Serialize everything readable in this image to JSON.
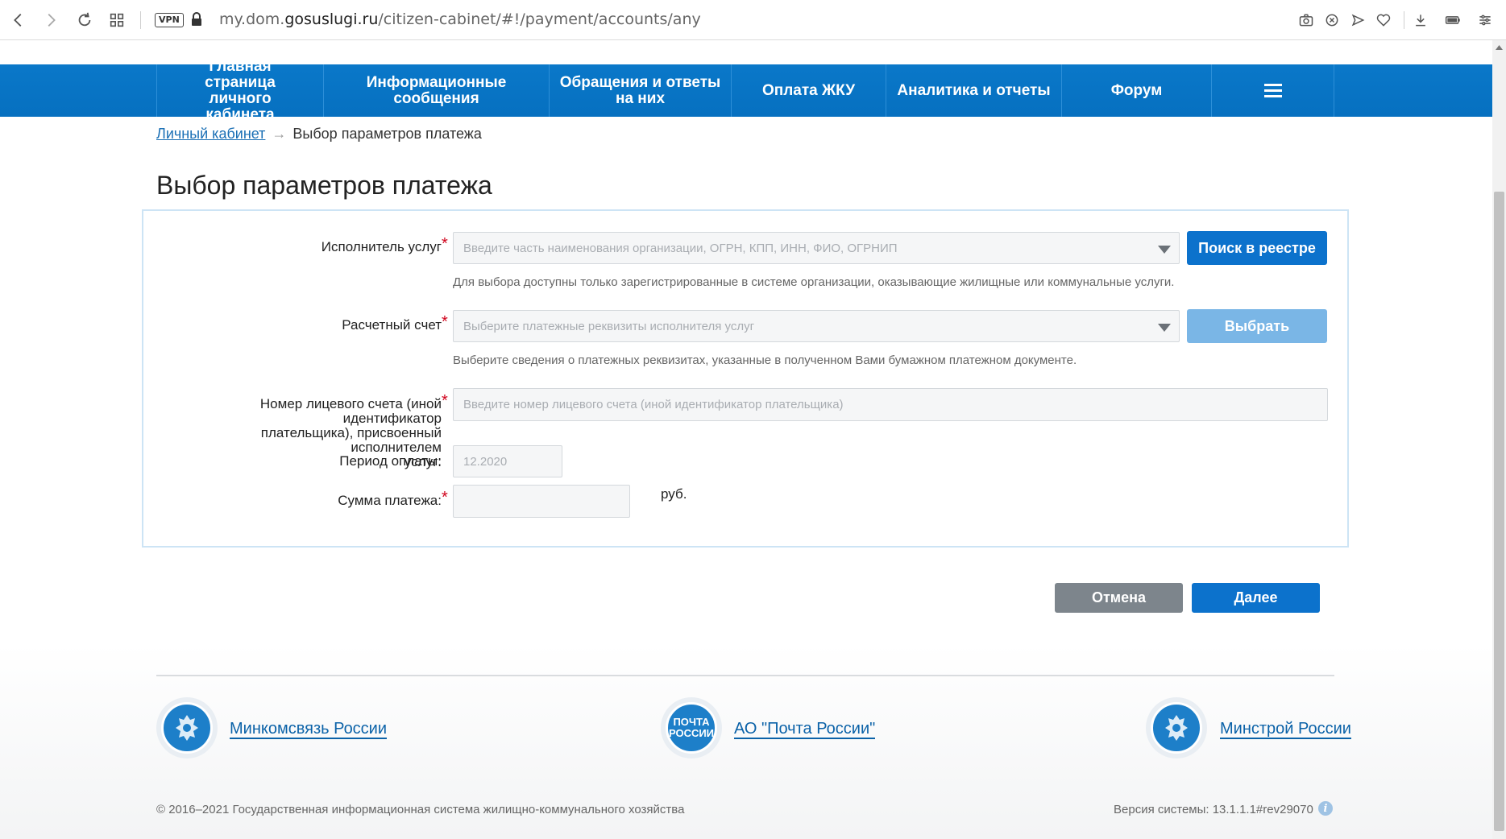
{
  "browser": {
    "vpn_label": "VPN",
    "url_prefix": "my.dom.",
    "url_host": "gosuslugi.ru",
    "url_path": "/citizen-cabinet/#!/payment/accounts/any",
    "icons": [
      "back-icon",
      "forward-icon",
      "reload-icon",
      "grid-icon",
      "lock-icon",
      "camera-icon",
      "close-circle-icon",
      "send-icon",
      "heart-icon",
      "download-icon",
      "battery-icon",
      "settings-icon"
    ]
  },
  "nav": {
    "items": [
      {
        "label": "Главная страница личного кабинета"
      },
      {
        "label": "Информационные сообщения"
      },
      {
        "label": "Обращения и ответы на них"
      },
      {
        "label": "Оплата ЖКУ"
      },
      {
        "label": "Аналитика и отчеты"
      },
      {
        "label": "Форум"
      }
    ],
    "menu_icon": "hamburger-icon"
  },
  "breadcrumb": {
    "link": "Личный кабинет",
    "arrow": "→",
    "current": "Выбор параметров платежа"
  },
  "page": {
    "title": "Выбор параметров платежа"
  },
  "form": {
    "provider": {
      "label": "Исполнитель услуг",
      "placeholder": "Введите часть наименования организации, ОГРН, КПП, ИНН, ФИО, ОГРНИП",
      "hint": "Для выбора доступны только зарегистрированные в системе организации, оказывающие жилищные или коммунальные услуги.",
      "button": "Поиск в реестре"
    },
    "account": {
      "label": "Расчетный счет",
      "placeholder": "Выберите платежные реквизиты исполнителя услуг",
      "hint": "Выберите сведения о платежных реквизитах, указанные в полученном Вами бумажном платежном документе.",
      "button": "Выбрать"
    },
    "personal_account": {
      "label_line1": "Номер лицевого счета (иной идентификатор",
      "label_line2": "плательщика), присвоенный исполнителем",
      "label_line3": "услуг:",
      "placeholder": "Введите номер лицевого счета (иной идентификатор плательщика)"
    },
    "period": {
      "label": "Период оплаты:",
      "value": "12.2020"
    },
    "amount": {
      "label": "Сумма платежа:",
      "value": "",
      "currency": "руб."
    },
    "required_mark": "*"
  },
  "actions": {
    "cancel": "Отмена",
    "next": "Далее"
  },
  "footer": {
    "partners": [
      {
        "name": "Минкомсвязь России"
      },
      {
        "name": "АО \"Почта России\"",
        "logo_text_1": "ПОЧТА",
        "logo_text_2": "РОССИИ"
      },
      {
        "name": "Минстрой России"
      }
    ],
    "copyright": "© 2016–2021 Государственная информационная система жилищно-коммунального хозяйства",
    "version": "Версия системы: 13.1.1.1#rev29070",
    "info_glyph": "i"
  }
}
